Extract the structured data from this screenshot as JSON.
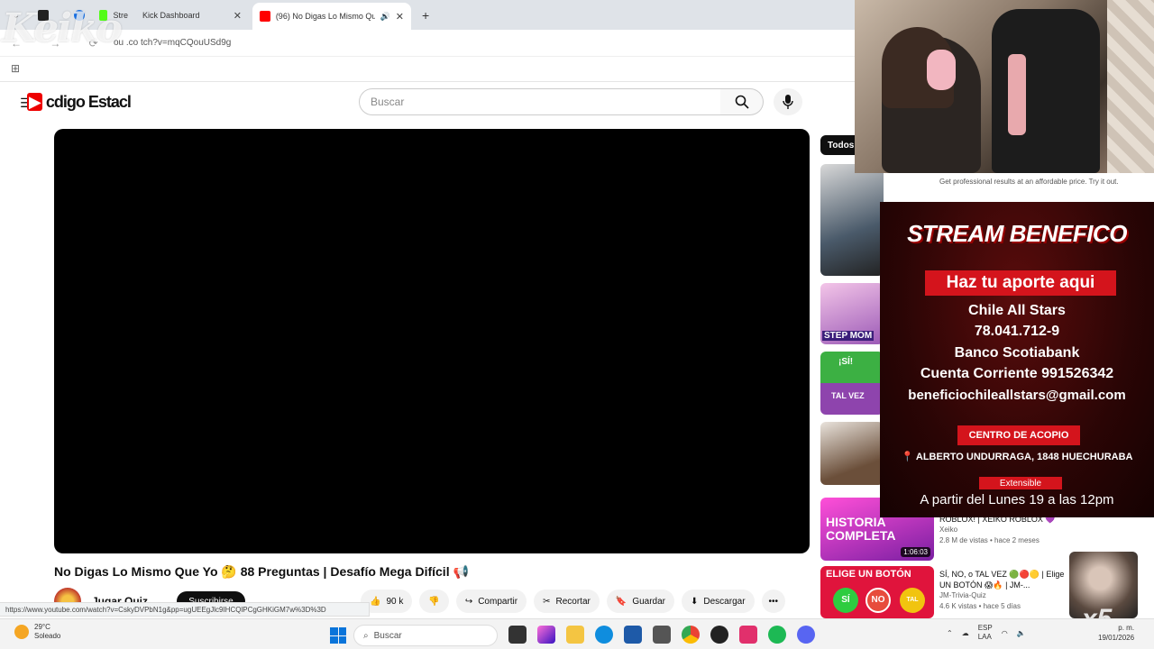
{
  "browser": {
    "tabs": [
      {
        "title": "Stre",
        "active": false
      },
      {
        "title": "Kick Dashboard",
        "active": false
      },
      {
        "title": "(96) No Digas Lo Mismo Qu",
        "active": true
      }
    ],
    "url_visible": "ou    .co     tch?v=mqCQouUSd9g",
    "status_url": "https://www.youtube.com/watch?v=CskyDVPbN1g&pp=ugUEEgJlc9IHCQlPCgGHKiGM7w%3D%3D"
  },
  "overlay": {
    "logo_text": "Keiko"
  },
  "youtube": {
    "logo": "YouTube",
    "logo_overlay": "cdigo Estacl",
    "search_placeholder": "Buscar",
    "video_title": "No Digas Lo Mismo Que Yo 🤔 88 Preguntas | Desafío Mega Difícil 📢",
    "channel_name": "Jugar Quiz",
    "subscribe": "Suscribirse",
    "actions": {
      "likes": "90 k",
      "share": "Compartir",
      "clip": "Recortar",
      "save": "Guardar",
      "download": "Descargar"
    },
    "chip_all": "Todos"
  },
  "sidebar_thumbs": {
    "step_mom": "STEP MOM",
    "si": "¡SÍ!",
    "tal_vez": "TAL VEZ",
    "historia": "HISTORIA COMPLETA",
    "historia_duration": "1:06:03",
    "elige": "ELIGE UN BOTÓN",
    "si2": "SÍ",
    "no": "NO",
    "tal_vez2": "TAL VEZ"
  },
  "recommendations": [
    {
      "title": "ROBLOX! | XEIKO ROBLOX 💜",
      "channel": "Xeiko",
      "meta": "2.8 M de vistas • hace 2 meses"
    },
    {
      "title": "SÍ, NO, o TAL VEZ 🟢🔴🟡 | Elige UN BOTÓN 😱🔥 | JM-...",
      "channel": "JM-Trivia-Quiz",
      "meta": "4.6 K vistas • hace 5 días"
    }
  ],
  "ad": {
    "text": "Get professional results at an affordable price. Try it out."
  },
  "promo": {
    "title": "STREAM BENEFICO",
    "cta": "Haz tu aporte aqui",
    "lines": [
      "Chile All Stars",
      "78.041.712-9",
      "Banco Scotiabank",
      "Cuenta Corriente 991526342",
      "beneficiochileallstars@gmail.com"
    ],
    "center": "CENTRO DE ACOPIO",
    "address": "ALBERTO UNDURRAGA, 1848 HUECHURABA",
    "extensible": "Extensible",
    "from": "A partir del Lunes 19 a las 12pm"
  },
  "stream_overlay": {
    "multiplier": "x5"
  },
  "taskbar": {
    "temp": "29°C",
    "weather": "Soleado",
    "search": "Buscar",
    "lang": "ESP",
    "lang2": "LAA",
    "time": "p. m.",
    "date": "19/01/2026"
  },
  "colors": {
    "accent_red": "#d4141c",
    "yt_red": "#ff0000",
    "dark": "#0f0f0f"
  }
}
